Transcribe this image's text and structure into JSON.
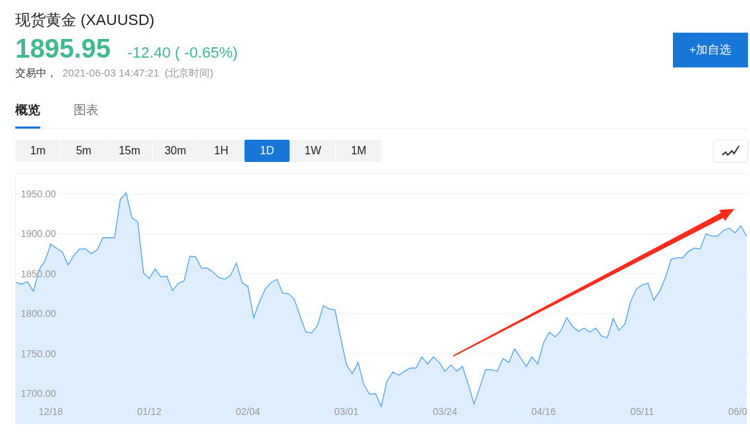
{
  "quote": {
    "title": "现货黄金 (XAUUSD)",
    "price": "1895.95",
    "change": "-12.40 ( -0.65%)",
    "status": "交易中，",
    "time": "2021-06-03 14:47:21",
    "timezone": "(北京时间)"
  },
  "add_button": {
    "label": "+加自选"
  },
  "tabs": [
    {
      "label": "概览",
      "selected": true
    },
    {
      "label": "图表",
      "selected": false
    }
  ],
  "intervals": [
    {
      "label": "1m",
      "selected": false
    },
    {
      "label": "5m",
      "selected": false
    },
    {
      "label": "15m",
      "selected": false
    },
    {
      "label": "30m",
      "selected": false
    },
    {
      "label": "1H",
      "selected": false
    },
    {
      "label": "1D",
      "selected": true
    },
    {
      "label": "1W",
      "selected": false
    },
    {
      "label": "1M",
      "selected": false
    }
  ],
  "chart": {
    "chart_data": {
      "type": "area",
      "grid": true,
      "categories": [
        null,
        null,
        null,
        null,
        null,
        null,
        "12/18",
        null,
        null,
        null,
        null,
        null,
        null,
        null,
        null,
        null,
        null,
        null,
        null,
        null,
        null,
        null,
        null,
        "01/12",
        null,
        null,
        null,
        null,
        null,
        null,
        null,
        null,
        null,
        null,
        null,
        null,
        null,
        null,
        null,
        null,
        "02/04",
        null,
        null,
        null,
        null,
        null,
        null,
        null,
        null,
        null,
        null,
        null,
        null,
        null,
        null,
        null,
        null,
        "03/01",
        null,
        null,
        null,
        null,
        null,
        null,
        null,
        null,
        null,
        null,
        null,
        null,
        null,
        null,
        null,
        null,
        "03/24",
        null,
        null,
        null,
        null,
        null,
        null,
        null,
        null,
        null,
        null,
        null,
        null,
        null,
        null,
        null,
        null,
        "04/16",
        null,
        null,
        null,
        null,
        null,
        null,
        null,
        null,
        null,
        null,
        null,
        null,
        null,
        null,
        null,
        null,
        "05/11",
        null,
        null,
        null,
        null,
        null,
        null,
        null,
        null,
        null,
        null,
        null,
        null,
        null,
        null,
        null,
        null,
        "06/0",
        null
      ],
      "series": [
        {
          "color": "#4da3f5",
          "values": [
            1839,
            1837,
            1840,
            1828,
            1855,
            1866,
            1887,
            1882,
            1877,
            1861,
            1873,
            1881,
            1881,
            1875,
            1880,
            1895,
            1895,
            1895,
            1943,
            1951,
            1920,
            1915,
            1851,
            1844,
            1856,
            1846,
            1847,
            1829,
            1838,
            1841,
            1872,
            1871,
            1857,
            1857,
            1852,
            1845,
            1843,
            1848,
            1863,
            1839,
            1834,
            1795,
            1815,
            1831,
            1839,
            1843,
            1826,
            1825,
            1818,
            1797,
            1777,
            1776,
            1785,
            1810,
            1806,
            1805,
            1770,
            1736,
            1725,
            1739,
            1711,
            1699,
            1700,
            1684,
            1716,
            1727,
            1723,
            1728,
            1732,
            1732,
            1746,
            1737,
            1746,
            1739,
            1728,
            1736,
            1728,
            1734,
            1712,
            1687,
            1708,
            1730,
            1730,
            1728,
            1744,
            1739,
            1756,
            1745,
            1734,
            1746,
            1737,
            1764,
            1777,
            1771,
            1779,
            1795,
            1784,
            1778,
            1782,
            1777,
            1782,
            1772,
            1770,
            1794,
            1779,
            1787,
            1815,
            1831,
            1836,
            1838,
            1817,
            1828,
            1845,
            1868,
            1870,
            1870,
            1878,
            1882,
            1881,
            1900,
            1897,
            1897,
            1904,
            1907,
            1901,
            1910,
            1897
          ]
        }
      ],
      "ylim": [
        1662,
        1975
      ],
      "yticks": [
        {
          "value": 1700,
          "label": "1700.00"
        },
        {
          "value": 1750,
          "label": "1750.00"
        },
        {
          "value": 1800,
          "label": "1800.00"
        },
        {
          "value": 1850,
          "label": "1850.00"
        },
        {
          "value": 1900,
          "label": "1900.00"
        },
        {
          "value": 1950,
          "label": "1950.00"
        }
      ],
      "orientation": "vertical"
    },
    "markup_arrow": {
      "color": "#ff2a1a"
    }
  }
}
